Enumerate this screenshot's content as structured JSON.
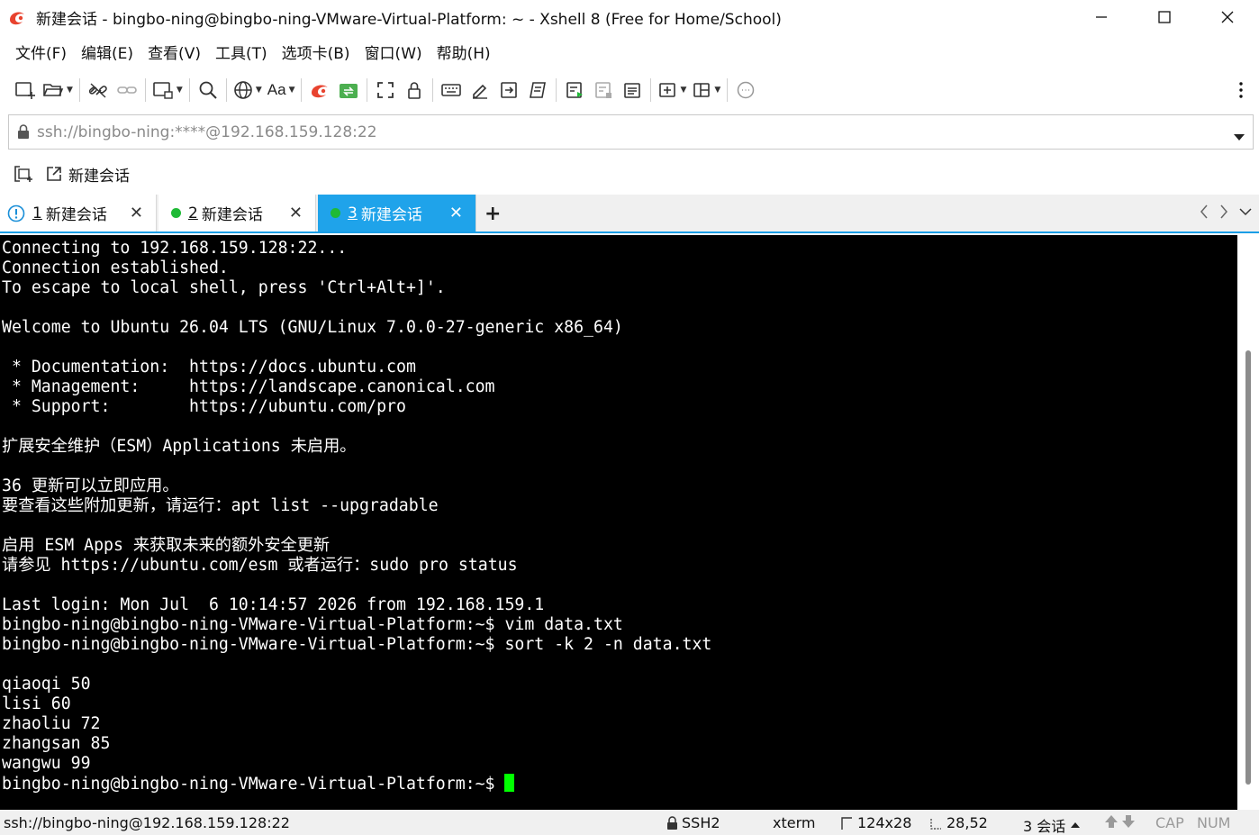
{
  "window": {
    "title": "新建会话 - bingbo-ning@bingbo-ning-VMware-Virtual-Platform: ~ - Xshell 8 (Free for Home/School)"
  },
  "menu": [
    "文件(F)",
    "编辑(E)",
    "查看(V)",
    "工具(T)",
    "选项卡(B)",
    "窗口(W)",
    "帮助(H)"
  ],
  "toolbar": {
    "font_label": "Aa",
    "icons": [
      "new-session-icon",
      "open-folder-icon",
      "disconnect-icon",
      "link-icon",
      "new-window-icon",
      "search-icon",
      "globe-icon",
      "font-icon",
      "xshell-icon",
      "xftp-icon",
      "fullscreen-icon",
      "lock-icon",
      "keyboard-icon",
      "compose-icon",
      "transfer-icon",
      "script-icon",
      "log-icon",
      "log-stop-icon",
      "notes-icon",
      "add-pane-icon",
      "layout-icon",
      "chat-icon",
      "more-icon"
    ]
  },
  "address": {
    "value": "ssh://bingbo-ning:****@192.168.159.128:22"
  },
  "quickbar": {
    "new_session_label": "新建会话"
  },
  "tabs": [
    {
      "index": "1",
      "label": "新建会话",
      "status": "warning",
      "active": false
    },
    {
      "index": "2",
      "label": "新建会话",
      "status": "connected",
      "active": false
    },
    {
      "index": "3",
      "label": "新建会话",
      "status": "connected",
      "active": true
    }
  ],
  "terminal": {
    "lines": [
      "Connecting to 192.168.159.128:22...",
      "Connection established.",
      "To escape to local shell, press 'Ctrl+Alt+]'.",
      "",
      "Welcome to Ubuntu 26.04 LTS (GNU/Linux 7.0.0-27-generic x86_64)",
      "",
      " * Documentation:  https://docs.ubuntu.com",
      " * Management:     https://landscape.canonical.com",
      " * Support:        https://ubuntu.com/pro",
      "",
      "扩展安全维护（ESM）Applications 未启用。",
      "",
      "36 更新可以立即应用。",
      "要查看这些附加更新，请运行：apt list --upgradable",
      "",
      "启用 ESM Apps 来获取未来的额外安全更新",
      "请参见 https://ubuntu.com/esm 或者运行：sudo pro status",
      "",
      "Last login: Mon Jul  6 10:14:57 2026 from 192.168.159.1",
      "bingbo-ning@bingbo-ning-VMware-Virtual-Platform:~$ vim data.txt",
      "bingbo-ning@bingbo-ning-VMware-Virtual-Platform:~$ sort -k 2 -n data.txt",
      "",
      "qiaoqi 50",
      "lisi 60",
      "zhaoliu 72",
      "zhangsan 85",
      "wangwu 99"
    ],
    "prompt": "bingbo-ning@bingbo-ning-VMware-Virtual-Platform:~$ ",
    "cursor_color": "#00ff00"
  },
  "status": {
    "connection": "ssh://bingbo-ning@192.168.159.128:22",
    "protocol": "SSH2",
    "term": "xterm",
    "size": "124x28",
    "position": "28,52",
    "sessions": "3 会话",
    "cap": "CAP",
    "num": "NUM"
  },
  "colors": {
    "accent": "#1fa3ea",
    "connected": "#1fba36",
    "terminal_bg": "#000000",
    "terminal_fg": "#ffffff"
  }
}
